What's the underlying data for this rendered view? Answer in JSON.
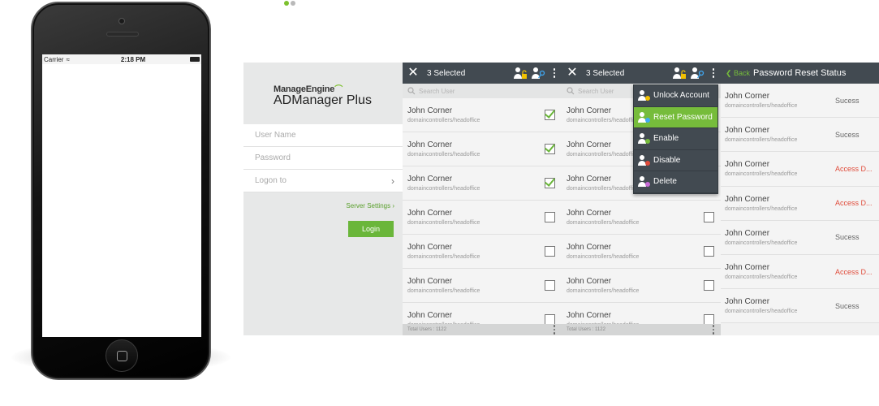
{
  "colors": {
    "accent": "#76bc3b",
    "header": "#424a51",
    "error": "#e04b3a"
  },
  "pager": {
    "dots": [
      {
        "color": "#7dc12e"
      },
      {
        "color": "#b9b9b9"
      }
    ]
  },
  "phone": {
    "carrier": "Carrier",
    "time": "2:18 PM"
  },
  "login": {
    "brand_top": "ManageEngine",
    "brand_main": "ADManager Plus",
    "username_placeholder": "User Name",
    "password_placeholder": "Password",
    "logon_to": "Logon to",
    "server_settings": "Server Settings",
    "login_button": "Login"
  },
  "list": {
    "selected": "3 Selected",
    "search_placeholder": "Search User",
    "footer": "Total Users : 1122",
    "rows": [
      {
        "name": "John Corner",
        "path": "domaincontrollers/headoffice",
        "checked": true
      },
      {
        "name": "John Corner",
        "path": "domaincontrollers/headoffice",
        "checked": true
      },
      {
        "name": "John Corner",
        "path": "domaincontrollers/headoffice",
        "checked": true
      },
      {
        "name": "John Corner",
        "path": "domaincontrollers/headoffice",
        "checked": false
      },
      {
        "name": "John Corner",
        "path": "domaincontrollers/headoffice",
        "checked": false
      },
      {
        "name": "John Corner",
        "path": "domaincontrollers/headoffice",
        "checked": false
      },
      {
        "name": "John Corner",
        "path": "domaincontrollers/headoffice",
        "checked": false
      }
    ]
  },
  "menu": {
    "items": [
      {
        "label": "Unlock Account",
        "icon": "unlock-user-icon",
        "active": false
      },
      {
        "label": "Reset Password",
        "icon": "key-user-icon",
        "active": true
      },
      {
        "label": "Enable",
        "icon": "enable-user-icon",
        "active": false
      },
      {
        "label": "Disable",
        "icon": "disable-user-icon",
        "active": false
      },
      {
        "label": "Delete",
        "icon": "delete-user-icon",
        "active": false
      }
    ]
  },
  "status": {
    "back": "Back",
    "title": "Password Reset Status",
    "rows": [
      {
        "name": "John Corner",
        "path": "domaincontrollers/headoffice",
        "status": "Sucess",
        "ok": true
      },
      {
        "name": "John Corner",
        "path": "domaincontrollers/headoffice",
        "status": "Sucess",
        "ok": true
      },
      {
        "name": "John Corner",
        "path": "domaincontrollers/headoffice",
        "status": "Access D...",
        "ok": false
      },
      {
        "name": "John Corner",
        "path": "domaincontrollers/headoffice",
        "status": "Access D...",
        "ok": false
      },
      {
        "name": "John Corner",
        "path": "domaincontrollers/headoffice",
        "status": "Sucess",
        "ok": true
      },
      {
        "name": "John Corner",
        "path": "domaincontrollers/headoffice",
        "status": "Access D...",
        "ok": false
      },
      {
        "name": "John Corner",
        "path": "domaincontrollers/headoffice",
        "status": "Sucess",
        "ok": true
      }
    ]
  }
}
